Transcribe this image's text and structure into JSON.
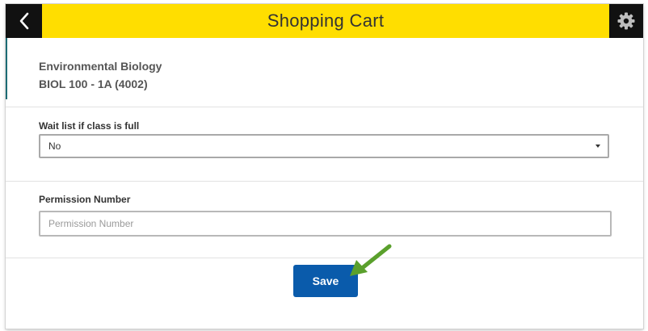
{
  "header": {
    "title": "Shopping Cart",
    "back_icon": "chevron-left-icon",
    "settings_icon": "gear-icon",
    "color": "#ffde00"
  },
  "course": {
    "name": "Environmental Biology",
    "section": "BIOL 100 - 1A (4002)"
  },
  "waitlist": {
    "label": "Wait list if class is full",
    "value": "No"
  },
  "permission": {
    "label": "Permission Number",
    "placeholder": "Permission Number",
    "value": ""
  },
  "actions": {
    "save_label": "Save",
    "save_color": "#0a5bab"
  },
  "annotation": {
    "arrow_color": "#5aa02c"
  }
}
